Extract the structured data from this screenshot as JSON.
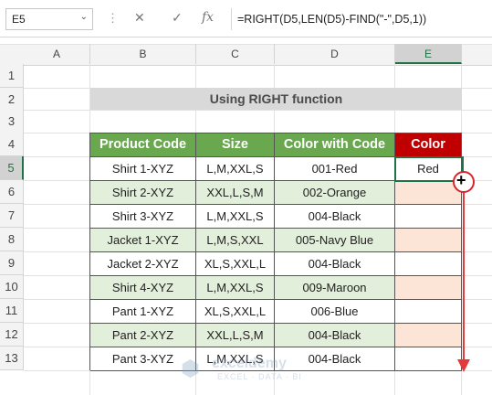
{
  "formula_bar": {
    "name_box": "E5",
    "cancel_icon": "✕",
    "enter_icon": "✓",
    "fx_label": "fx",
    "formula": "=RIGHT(D5,LEN(D5)-FIND(\"-\",D5,1))"
  },
  "columns": [
    "A",
    "B",
    "C",
    "D",
    "E"
  ],
  "selected_column": "E",
  "rows": [
    "1",
    "2",
    "3",
    "4",
    "5",
    "6",
    "7",
    "8",
    "9",
    "10",
    "11",
    "12",
    "13"
  ],
  "selected_row": "5",
  "title": "Using RIGHT function",
  "table": {
    "headers": [
      "Product Code",
      "Size",
      "Color with Code",
      "Color"
    ],
    "rows": [
      [
        "Shirt 1-XYZ",
        "L,M,XXL,S",
        "001-Red",
        "Red"
      ],
      [
        "Shirt 2-XYZ",
        "XXL,L,S,M",
        "002-Orange",
        ""
      ],
      [
        "Shirt 3-XYZ",
        "L,M,XXL,S",
        "004-Black",
        ""
      ],
      [
        "Jacket 1-XYZ",
        "L,M,S,XXL",
        "005-Navy Blue",
        ""
      ],
      [
        "Jacket 2-XYZ",
        "XL,S,XXL,L",
        "004-Black",
        ""
      ],
      [
        "Shirt 4-XYZ",
        "L,M,XXL,S",
        "009-Maroon",
        ""
      ],
      [
        "Pant 1-XYZ",
        "XL,S,XXL,L",
        "006-Blue",
        ""
      ],
      [
        "Pant 2-XYZ",
        "XXL,L,S,M",
        "004-Black",
        ""
      ],
      [
        "Pant 3-XYZ",
        "L,M,XXL,S",
        "004-Black",
        ""
      ]
    ]
  },
  "watermark": {
    "name": "exceldemy",
    "tagline": "EXCEL · DATA · BI"
  },
  "colors": {
    "header_green": "#6aa84f",
    "header_red": "#c00000",
    "row_alt": "#e2efda",
    "fill_pink": "#fce4d6",
    "arrow_red": "#e33b3b",
    "excel_green": "#217346"
  }
}
